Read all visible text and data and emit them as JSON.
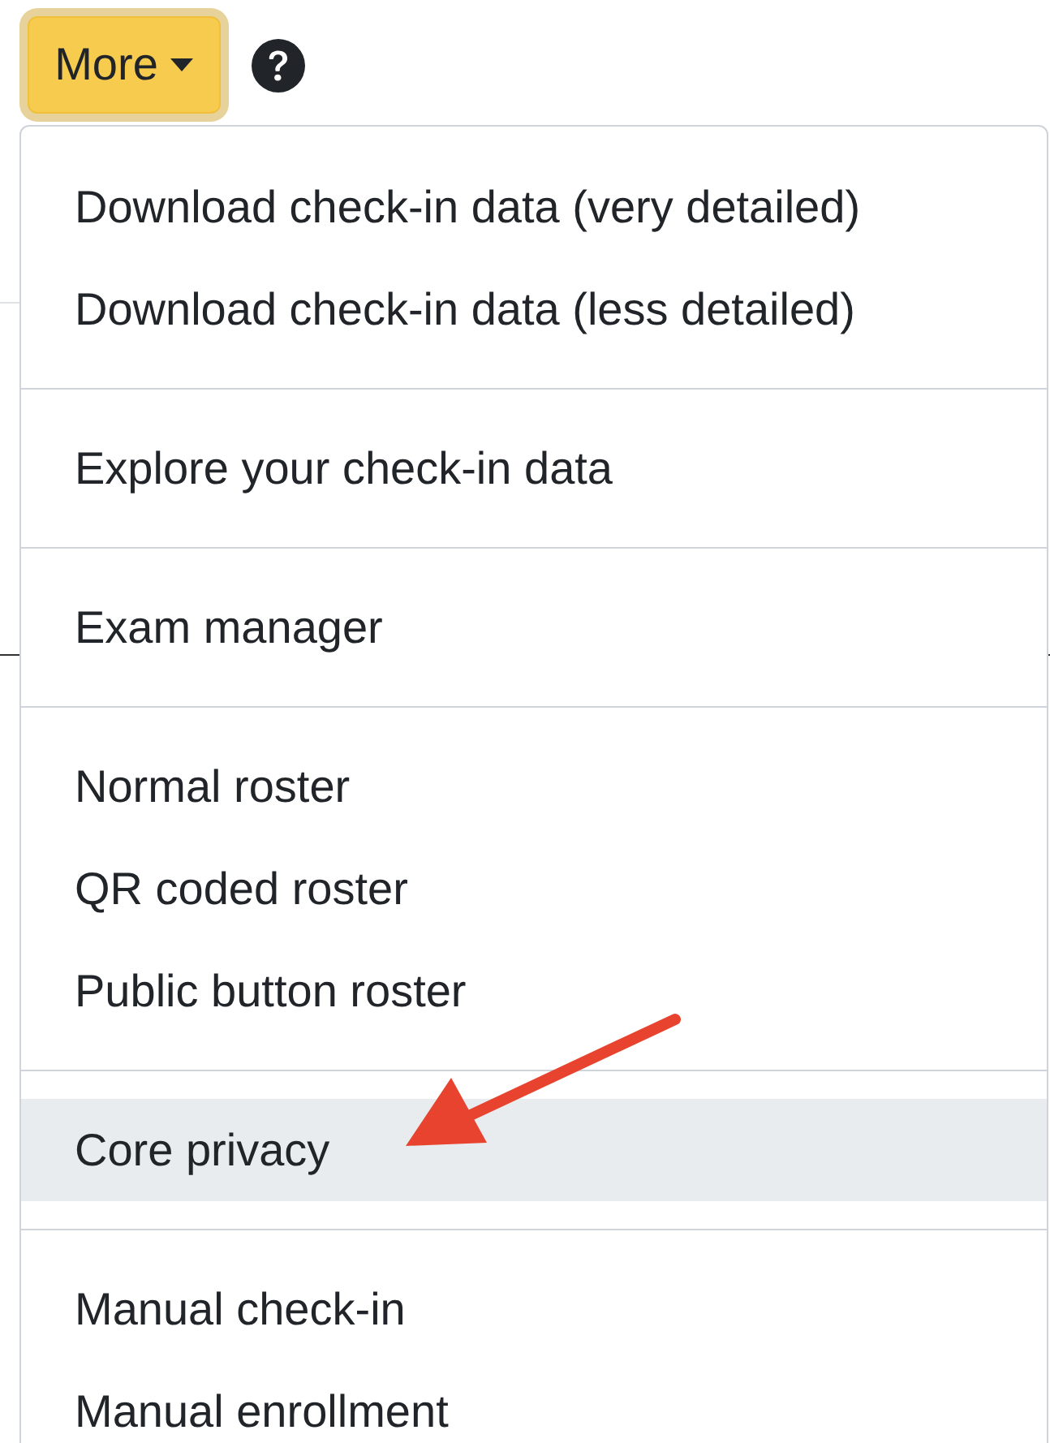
{
  "button": {
    "label": "More",
    "expanded": true
  },
  "menu": {
    "groups": [
      {
        "items": [
          {
            "label": "Download check-in data (very detailed)",
            "selected": false
          },
          {
            "label": "Download check-in data (less detailed)",
            "selected": false
          }
        ]
      },
      {
        "items": [
          {
            "label": "Explore your check-in data",
            "selected": false
          }
        ]
      },
      {
        "items": [
          {
            "label": "Exam manager",
            "selected": false
          }
        ]
      },
      {
        "items": [
          {
            "label": "Normal roster",
            "selected": false
          },
          {
            "label": "QR coded roster",
            "selected": false
          },
          {
            "label": "Public button roster",
            "selected": false
          }
        ]
      },
      {
        "items": [
          {
            "label": "Core privacy",
            "selected": true
          }
        ]
      },
      {
        "items": [
          {
            "label": "Manual check-in",
            "selected": false
          },
          {
            "label": "Manual enrollment",
            "selected": false
          }
        ]
      }
    ]
  }
}
